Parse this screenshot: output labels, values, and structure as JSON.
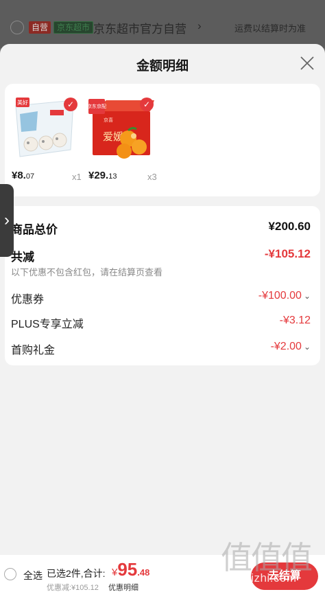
{
  "background_header": {
    "tag_self": "自营",
    "tag_market": "京东超市",
    "store_name": "京东超市官方自营",
    "chevron": "›",
    "shipping_note": "运费以结算时为准"
  },
  "sheet": {
    "title": "金额明细",
    "close_icon": "close-icon"
  },
  "products": [
    {
      "price_int": "¥8.",
      "price_dec": "07",
      "qty": "x1",
      "checked": true,
      "image_icon": "frozen-dumplings-package"
    },
    {
      "price_int": "¥29.",
      "price_dec": "13",
      "qty": "x3",
      "checked": true,
      "image_icon": "orange-gift-box"
    }
  ],
  "product_images": {
    "p1_brand": "美好",
    "p2_brand": "京喜",
    "p2_tag": "京东京配",
    "p2_product": "爱媛"
  },
  "price_details": {
    "goods_total_label": "商品总价",
    "goods_total_value": "¥200.60",
    "total_discount_label": "共减",
    "total_discount_value": "-¥105.12",
    "discount_note": "以下优惠不包含红包，请在结算页查看",
    "coupon_label": "优惠券",
    "coupon_value": "-¥100.00",
    "plus_label": "PLUS专享立减",
    "plus_value": "-¥3.12",
    "first_buy_label": "首购礼金",
    "first_buy_value": "-¥2.00"
  },
  "bottom_bar": {
    "select_all": "全选",
    "selected_summary": "已选2件,合计:",
    "total_yuan": "¥",
    "total_int": "95",
    "total_dec": ".48",
    "discount_summary": "优惠减:¥105.12",
    "detail_link": "优惠明细",
    "checkout": "去结算"
  },
  "watermark": {
    "glyphs": "值值值",
    "site": "zhizhizhi.com"
  },
  "colors": {
    "accent_red": "#e4393c",
    "sheet_bg": "#f2f2f2"
  }
}
